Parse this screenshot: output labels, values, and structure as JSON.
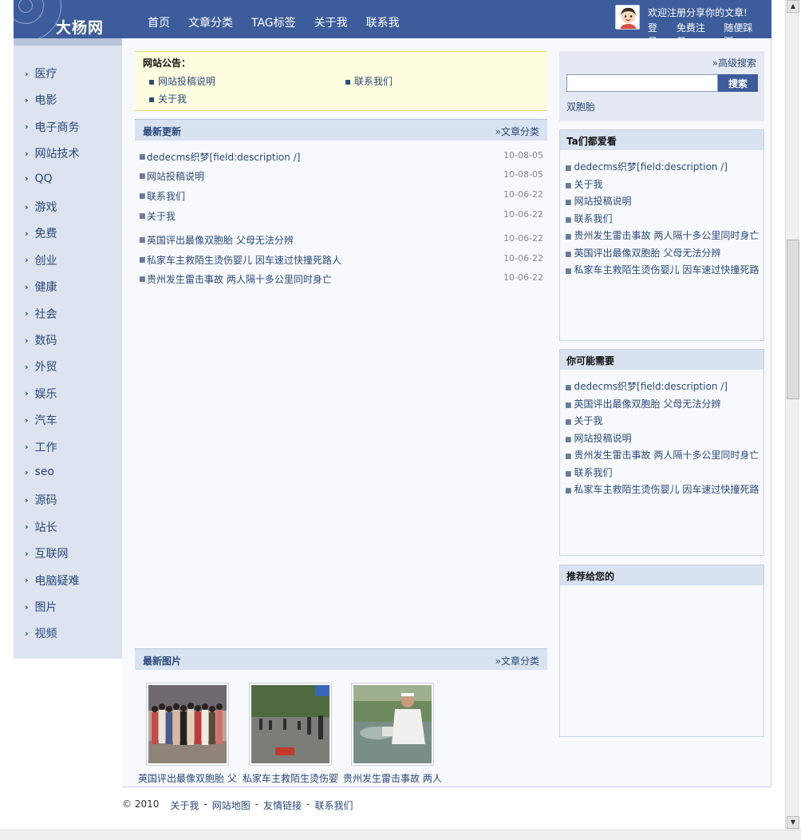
{
  "header": {
    "logo": "大杨网",
    "nav": [
      "首页",
      "文章分类",
      "TAG标签",
      "关于我",
      "联系我"
    ],
    "welcome": "欢迎注册分享你的文章!",
    "user_links": [
      "登录",
      "免费注册",
      "随便踩踩"
    ]
  },
  "sidebar": {
    "items": [
      "医疗",
      "电影",
      "电子商务",
      "网站技术",
      "QQ",
      "游戏",
      "免费",
      "创业",
      "健康",
      "社会",
      "数码",
      "外贸",
      "娱乐",
      "汽车",
      "工作",
      "seo",
      "源码",
      "站长",
      "互联网",
      "电脑疑难",
      "图片",
      "视频"
    ]
  },
  "notice": {
    "title": "网站公告：",
    "links": [
      "网站投稿说明",
      "联系我们",
      "关于我"
    ]
  },
  "latest": {
    "title": "最新更新",
    "more": "»文章分类",
    "items": [
      {
        "title": "dedecms织梦[field:description /]",
        "date": "10-08-05"
      },
      {
        "title": "网站投稿说明",
        "date": "10-08-05"
      },
      {
        "title": "联系我们",
        "date": "10-06-22"
      },
      {
        "title": "关于我",
        "date": "10-06-22"
      },
      {
        "title": "英国评出最像双胞胎 父母无法分辨",
        "date": "10-06-22"
      },
      {
        "title": "私家车主救陌生烫伤婴儿 因车速过快撞死路人",
        "date": "10-06-22"
      },
      {
        "title": "贵州发生雷击事故 两人隔十多公里同时身亡",
        "date": "10-06-22"
      }
    ]
  },
  "pictures": {
    "title": "最新图片",
    "more": "»文章分类",
    "items": [
      {
        "caption": "英国评出最像双胞胎 父"
      },
      {
        "caption": "私家车主救陌生烫伤婴"
      },
      {
        "caption": "贵州发生雷击事故 两人"
      }
    ]
  },
  "search": {
    "advanced": "»高级搜索",
    "value": "",
    "button": "搜索",
    "hot_keyword": "双胞胎"
  },
  "popular": {
    "title": "Ta们都爱看",
    "items": [
      "dedecms织梦[field:description /]",
      "关于我",
      "网站投稿说明",
      "联系我们",
      "贵州发生雷击事故 两人隔十多公里同时身亡",
      "英国评出最像双胞胎 父母无法分辨",
      "私家车主救陌生烫伤婴儿 因车速过快撞死路"
    ]
  },
  "maybe": {
    "title": "你可能需要",
    "items": [
      "dedecms织梦[field:description /]",
      "英国评出最像双胞胎 父母无法分辨",
      "关于我",
      "网站投稿说明",
      "贵州发生雷击事故 两人隔十多公里同时身亡",
      "联系我们",
      "私家车主救陌生烫伤婴儿 因车速过快撞死路"
    ]
  },
  "recommend": {
    "title": "推荐给您的"
  },
  "footer": {
    "copyright": "© 2010",
    "links": [
      "关于我",
      "网站地图",
      "友情链接",
      "联系我们"
    ],
    "separator": "-"
  },
  "colors": {
    "header_bg": "#3d5c9b",
    "sidebar_bg": "#dde3ef",
    "panel_head_bg": "#d8e2f0",
    "notice_bg": "#fffde0",
    "link": "#2a4a7a"
  }
}
